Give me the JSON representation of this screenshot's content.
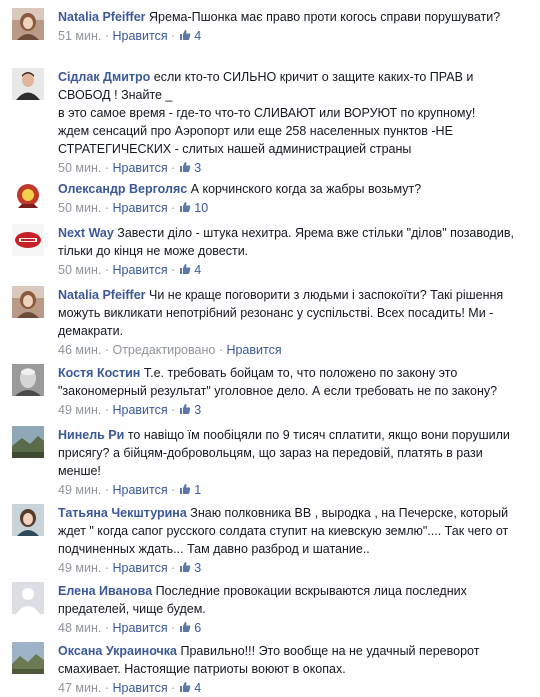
{
  "comments": [
    {
      "author": "Natalia Pfeiffer",
      "text": "Ярема-Пшонка має право проти когось справи порушувати?",
      "time": "51 мин.",
      "like_label": "Нравится",
      "likes": "4",
      "edited": "",
      "avatar_icon": "woman-photo-icon"
    },
    {
      "author": "Сiдлак Дмитро",
      "text": "если кто-то СИЛЬНО кричит о защите каких-то ПРАВ и СВОБОД ! Знайте _\nв это самое время - где-то что-то СЛИВАЮТ или ВОРУЮТ по крупному!\nждем сенсаций про Аэропорт или еще 258 населенных пунктов -НЕ СТРАТЕГИЧЕСКИХ - слитых нашей администрацией страны",
      "time": "50 мин.",
      "like_label": "Нравится",
      "likes": "3",
      "edited": "",
      "avatar_icon": "man-photo-icon"
    },
    {
      "author": "Олександр Верголяс",
      "text": "А корчинского когда за жабры возьмут?",
      "time": "50 мин.",
      "like_label": "Нравится",
      "likes": "10",
      "edited": "",
      "avatar_icon": "emblem-icon"
    },
    {
      "author": "Next Way",
      "text": "Завести діло - штука нехитра. Ярема вже стільки \"ділов\" позаводив, тільки до кінця не може довести.",
      "time": "50 мин.",
      "like_label": "Нравится",
      "likes": "4",
      "edited": "",
      "avatar_icon": "logo-icon"
    },
    {
      "author": "Natalia Pfeiffer",
      "text": "Чи не краще поговорити з людьми і заспокоїти? Такі рішення можуть викликати непотрібний резонанс у суспільстві. Всех посадить! Ми - демакрати.",
      "time": "46 мин.",
      "like_label": "Нравится",
      "likes": "",
      "edited": "Отредактировано",
      "avatar_icon": "woman-photo-icon"
    },
    {
      "author": "Костя Костин",
      "text": "Т.е. требовать бойцам то, что положено по закону это \"закономерный результат\" уголовное дело. А если требовать не по закону?",
      "time": "49 мин.",
      "like_label": "Нравится",
      "likes": "3",
      "edited": "",
      "avatar_icon": "portrait-bw-icon"
    },
    {
      "author": "Нинель Ри",
      "text": "то навіщо їм пообіцяли по 9 тисяч сплатити, якщо вони порушили присягу? а бійцям-добровольцям, що зараз на передовій, платять в рази менше!",
      "time": "49 мин.",
      "like_label": "Нравится",
      "likes": "1",
      "edited": "",
      "avatar_icon": "landscape-photo-icon"
    },
    {
      "author": "Татьяна Чекштурина",
      "text": "Знаю полковника ВВ , выродка , на Печерске, который ждет \" когда сапог русского солдата ступит на киевскую землю\".... Так чего от подчиненных ждать... Там давно разброд и шатание..",
      "time": "49 мин.",
      "like_label": "Нравится",
      "likes": "3",
      "edited": "",
      "avatar_icon": "woman-photo-icon"
    },
    {
      "author": "Елена Иванова",
      "text": "Последние провокации вскрываются лица последних предателей, чище будем.",
      "time": "48 мин.",
      "like_label": "Нравится",
      "likes": "6",
      "edited": "",
      "avatar_icon": "default-avatar-icon"
    },
    {
      "author": "Оксана Украиночка",
      "text": "Правильно!!! Это вообще на не удачный переворот смахивает. Настоящие патриоты воюют в окопах.",
      "time": "47 мин.",
      "like_label": "Нравится",
      "likes": "4",
      "edited": "",
      "avatar_icon": "landscape-photo-icon"
    }
  ]
}
